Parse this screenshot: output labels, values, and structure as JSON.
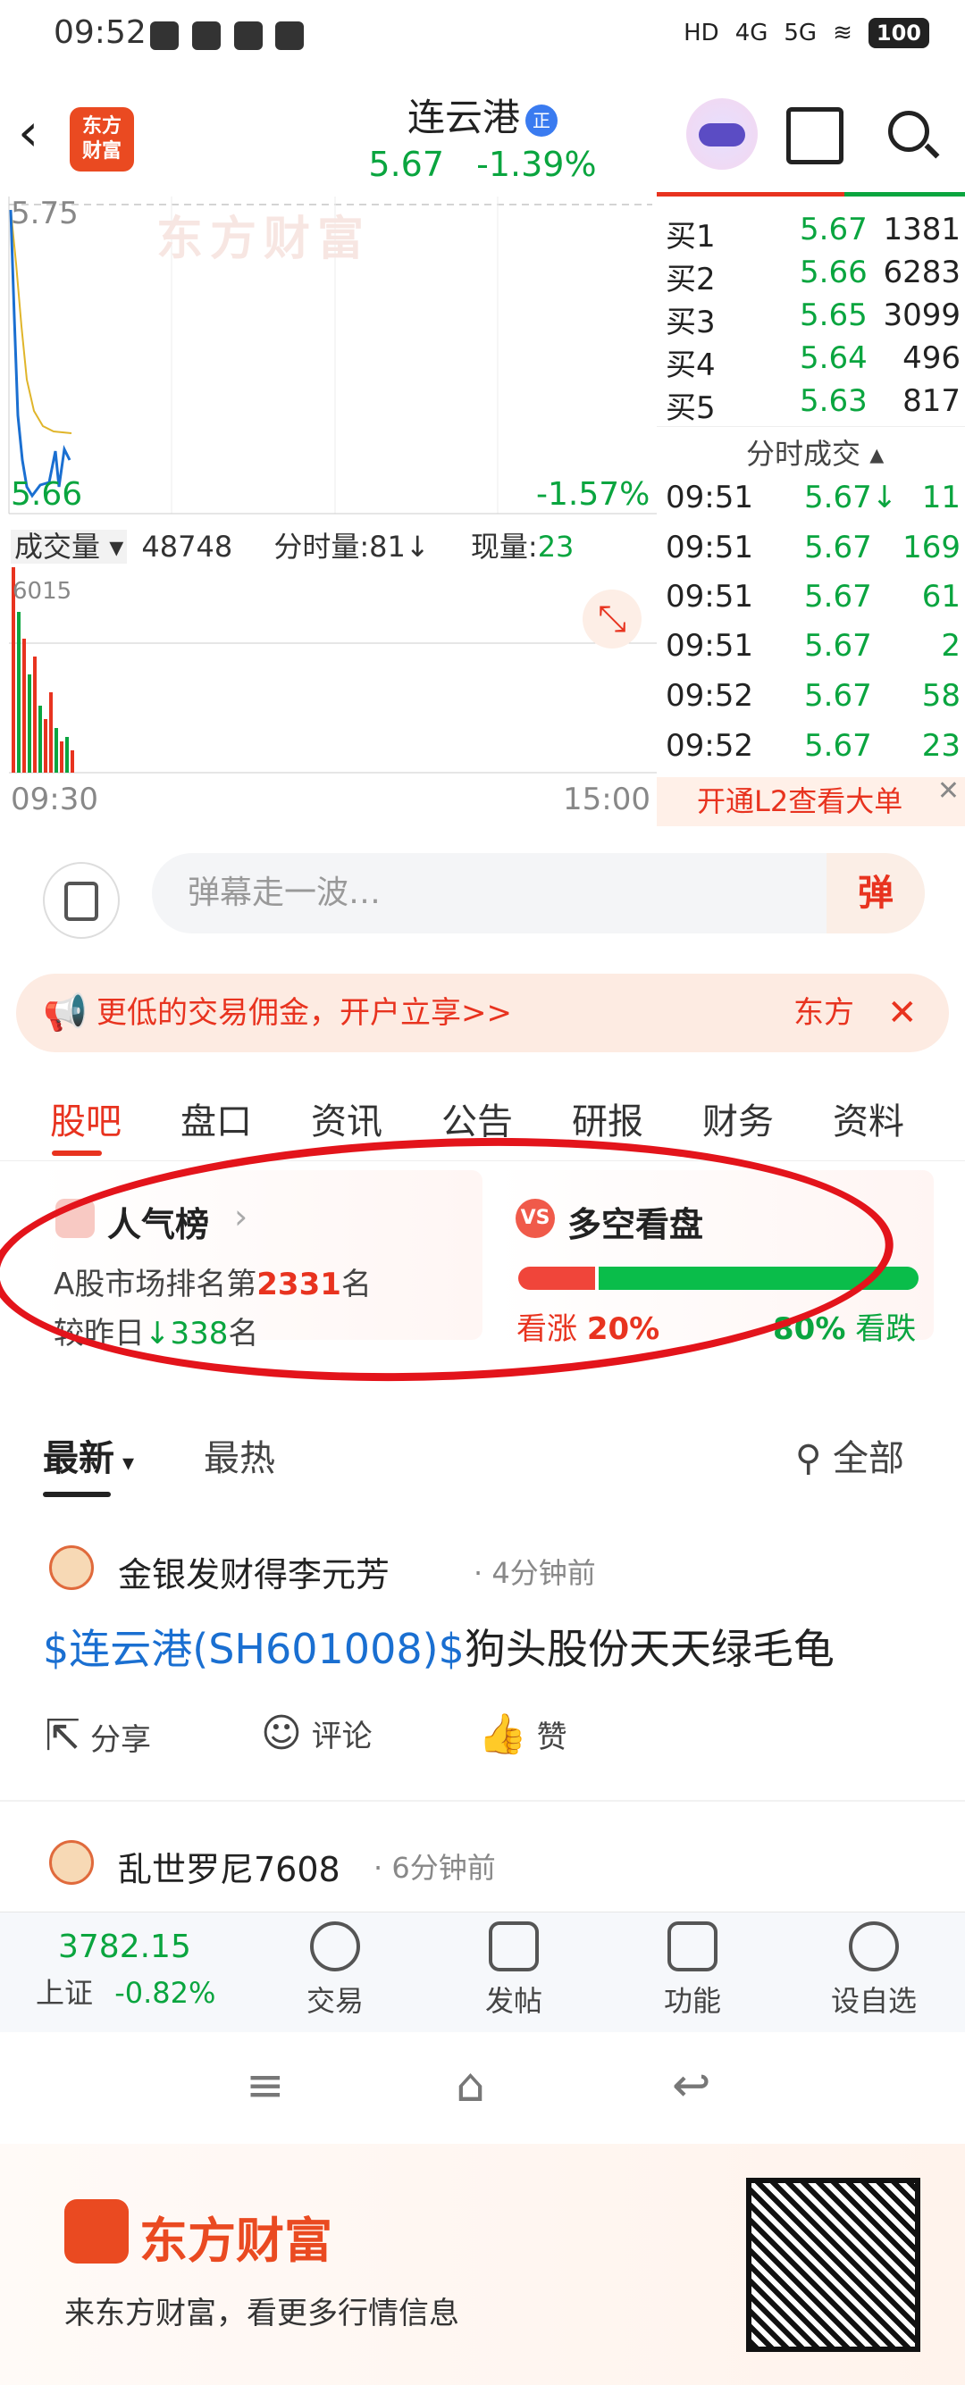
{
  "status_bar": {
    "time": "09:52",
    "signal1": "4G",
    "signal2": "5G",
    "battery": "100"
  },
  "header": {
    "logo_text": "东方\n财富",
    "stock_name": "连云港",
    "badge": "正",
    "price": "5.67",
    "change_pct": "-1.39%"
  },
  "chart": {
    "y_top_label": "5.75",
    "y_bottom_label": "5.66",
    "bottom_pct": "-1.57%",
    "volume_label": "成交量",
    "volume_value": "48748",
    "minute_volume": "分时量:81↓",
    "now_volume_label": "现量:",
    "now_volume_value": "23",
    "volume_axis_max": "6015",
    "time_start": "09:30",
    "time_end": "15:00",
    "watermark": "东方财富"
  },
  "order_book": {
    "rows": [
      {
        "label": "买1",
        "price": "5.67",
        "volume": "1381"
      },
      {
        "label": "买2",
        "price": "5.66",
        "volume": "6283"
      },
      {
        "label": "买3",
        "price": "5.65",
        "volume": "3099"
      },
      {
        "label": "买4",
        "price": "5.64",
        "volume": "496"
      },
      {
        "label": "买5",
        "price": "5.63",
        "volume": "817"
      }
    ],
    "ticks_header": "分时成交",
    "ticks": [
      {
        "time": "09:51",
        "price": "5.67↓",
        "volume": "11"
      },
      {
        "time": "09:51",
        "price": "5.67",
        "volume": "169"
      },
      {
        "time": "09:51",
        "price": "5.67",
        "volume": "61"
      },
      {
        "time": "09:51",
        "price": "5.67",
        "volume": "2"
      },
      {
        "time": "09:52",
        "price": "5.67",
        "volume": "58"
      },
      {
        "time": "09:52",
        "price": "5.67",
        "volume": "23"
      }
    ],
    "l2_banner": "开通L2查看大单"
  },
  "comment": {
    "placeholder": "弹幕走一波…",
    "danmu_button": "弹"
  },
  "promo": {
    "text": "更低的交易佣金，开户立享>>",
    "right_text": "东方"
  },
  "tabs": [
    "股吧",
    "盘口",
    "资讯",
    "公告",
    "研报",
    "财务",
    "资料"
  ],
  "popularity": {
    "title": "人气榜",
    "rank_prefix": "A股市场排名第",
    "rank_value": "2331",
    "rank_suffix": "名",
    "compare_prefix": "较昨日",
    "compare_value": "338",
    "compare_suffix": "名"
  },
  "sentiment": {
    "title": "多空看盘",
    "bull_label": "看涨",
    "bull_pct": "20%",
    "bear_pct": "80%",
    "bear_label": "看跌",
    "bull_fraction": 0.2
  },
  "feed_filter": {
    "latest": "最新",
    "hot": "最热",
    "all": "全部"
  },
  "posts": [
    {
      "author": "金银发财得李元芳",
      "time": "4分钟前",
      "link": "$连云港(SH601008)$",
      "text": "狗头股份天天绿毛龟",
      "share": "分享",
      "comment": "评论",
      "like": "赞"
    },
    {
      "author": "乱世罗尼7608",
      "time": "6分钟前"
    }
  ],
  "bottom_nav": {
    "index_value": "3782.15",
    "index_name": "上证",
    "index_change": "-0.82%",
    "items": [
      "交易",
      "发帖",
      "功能",
      "设自选"
    ]
  },
  "footer": {
    "brand": "东方财富",
    "slogan": "来东方财富，看更多行情信息"
  },
  "colors": {
    "accent": "#e8331f",
    "down": "#0aa53f",
    "up": "#e8331f"
  }
}
